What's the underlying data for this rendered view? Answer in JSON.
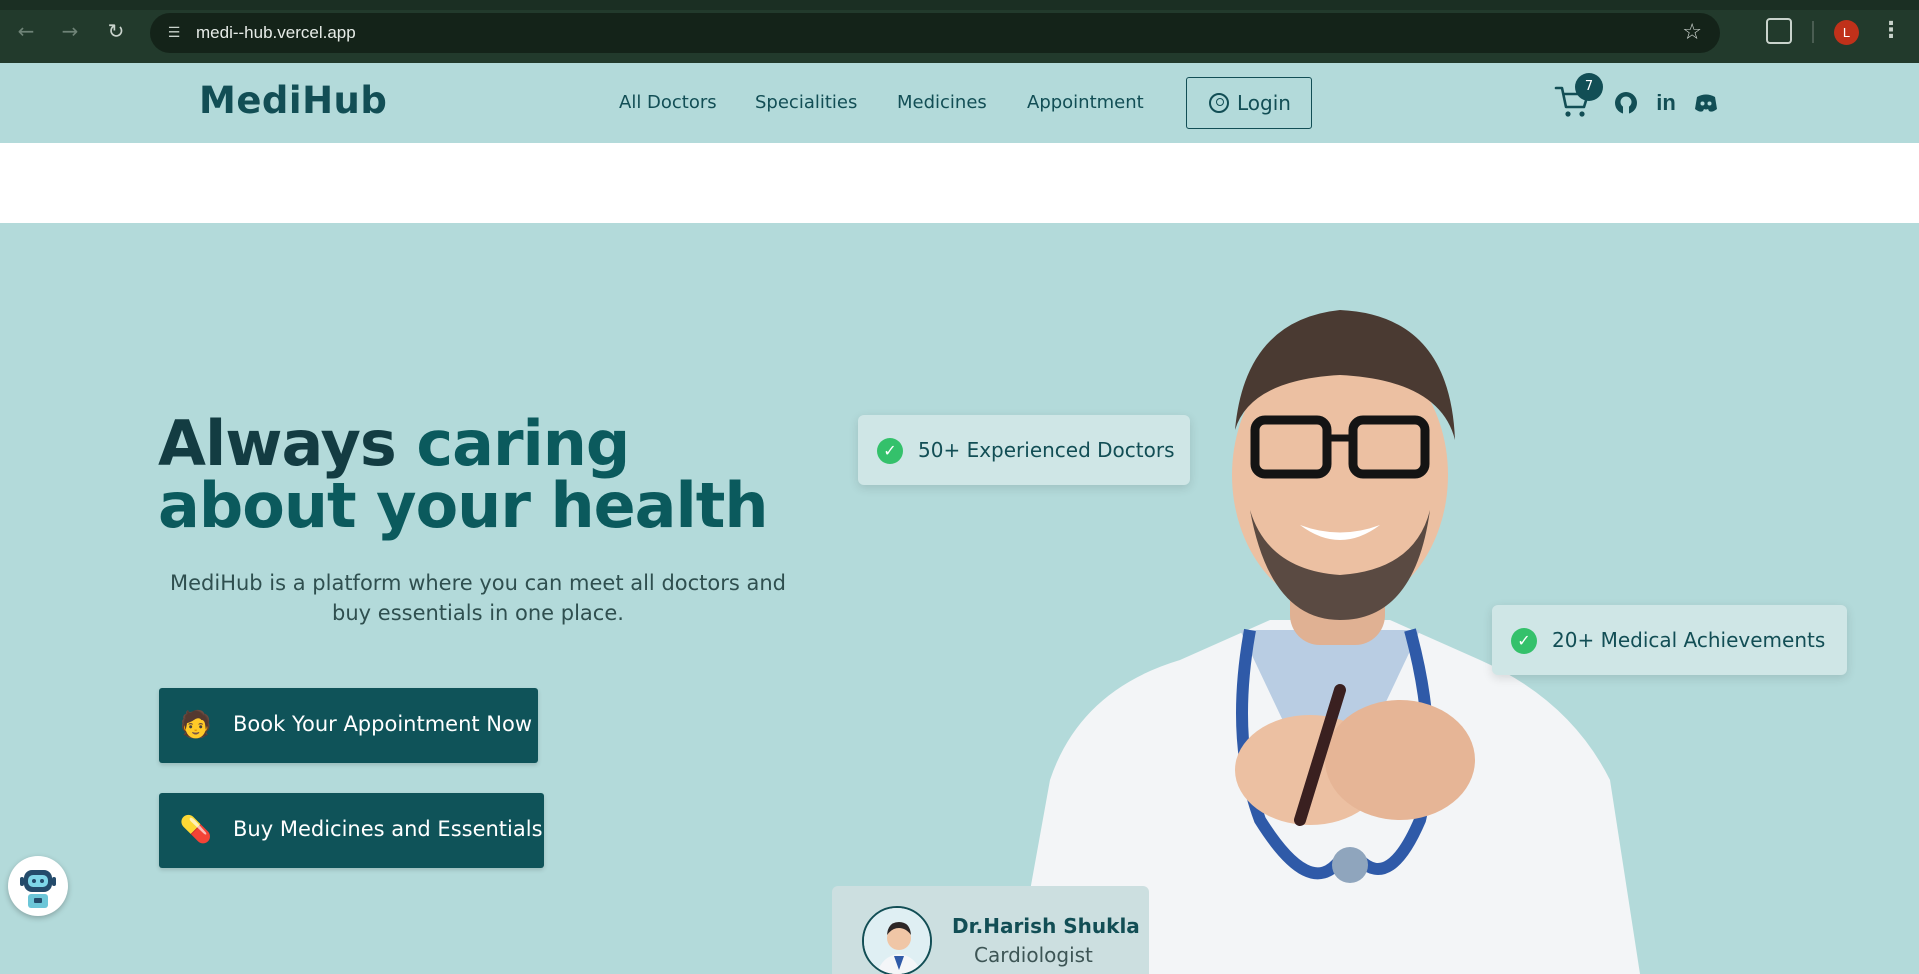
{
  "browser": {
    "url": "medi--hub.vercel.app",
    "profile_initial": "L"
  },
  "site": {
    "logo": "MediHub",
    "nav": [
      "All Doctors",
      "Specialities",
      "Medicines",
      "Appointment"
    ],
    "login_label": "Login",
    "cart_count": "7",
    "social_icons": [
      "github-icon",
      "linkedin-icon",
      "discord-icon"
    ]
  },
  "hero": {
    "headline_part1": "Always",
    "headline_part2": "caring about your health",
    "subtitle": "MediHub is a platform where you can meet all doctors and buy essentials in one place.",
    "cta_primary": "Book Your Appointment Now",
    "cta_secondary": "Buy Medicines and Essentials",
    "stat_1": "50+ Experienced Doctors",
    "stat_2": "20+ Medical Achievements",
    "doctor_name": "Dr.Harish Shukla",
    "doctor_specialty": "Cardiologist"
  },
  "colors": {
    "brand": "#124e55",
    "background": "#b3dada",
    "button": "#0f5359",
    "check": "#34c16b"
  }
}
